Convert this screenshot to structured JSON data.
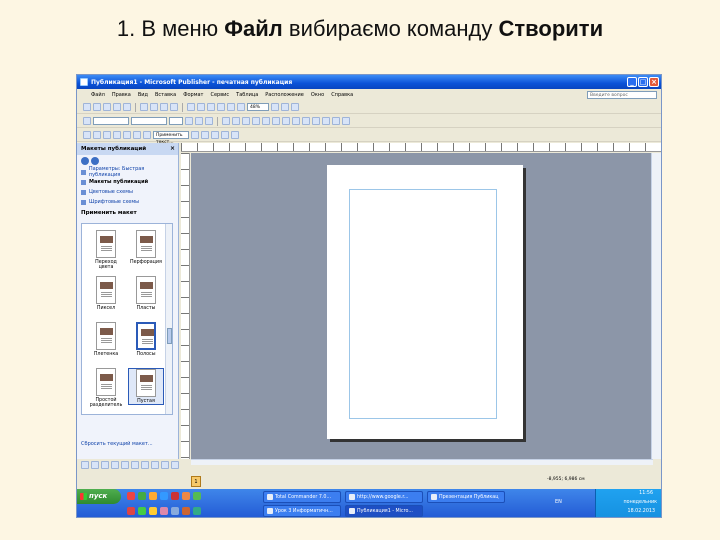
{
  "slide": {
    "title_prefix": "1. В меню ",
    "title_menu": "Файл",
    "title_middle": " вибираємо команду ",
    "title_command": "Створити"
  },
  "window": {
    "title": "Публикация1 - Microsoft Publisher - печатная публикация",
    "menu": [
      "Файл",
      "Правка",
      "Вид",
      "Вставка",
      "Формат",
      "Сервис",
      "Таблица",
      "Расположение",
      "Окно",
      "Справка"
    ],
    "ask_placeholder": "Введите вопрос",
    "zoom": "48%",
    "font_combo": "Применить текст..."
  },
  "task_pane": {
    "header": "Макеты публикаций",
    "links": [
      "Параметры: Быстрая публикация",
      "Макеты публикаций",
      "Цветовые схемы",
      "Шрифтовые схемы"
    ],
    "section": "Применить макет",
    "layouts": [
      "Переход цвета",
      "Перфорация",
      "Пиксел",
      "Пласты",
      "Плетенка",
      "Полосы",
      "Простой разделитель",
      "Пустая"
    ],
    "reset": "Сбросить текущий макет..."
  },
  "status": {
    "page": "1",
    "coords": "-8,955; 6,986 см"
  },
  "taskbar": {
    "start": "пуск",
    "tasks": [
      "Total Commander 7.0...",
      "http://www.google.r...",
      "Презентация Публикац",
      "Урок 3 Информатичн...",
      "Публикация1 - Micro..."
    ],
    "lang": "EN",
    "time": "11:56",
    "day": "понедельник",
    "date": "18.02.2013"
  },
  "colors": {
    "titlebar": "#0a52d8",
    "start_green": "#2f8a2f",
    "workspace": "#8c96a8"
  }
}
